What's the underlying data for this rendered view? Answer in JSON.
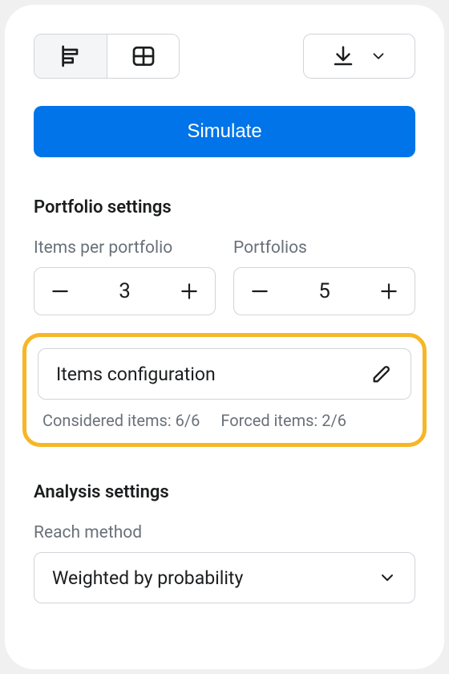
{
  "toolbar": {
    "simulate_label": "Simulate"
  },
  "portfolio": {
    "title": "Portfolio settings",
    "items_per_portfolio": {
      "label": "Items per portfolio",
      "value": "3"
    },
    "portfolios": {
      "label": "Portfolios",
      "value": "5"
    },
    "config": {
      "label": "Items configuration",
      "considered": "Considered items: 6/6",
      "forced": "Forced items: 2/6"
    }
  },
  "analysis": {
    "title": "Analysis settings",
    "reach_method": {
      "label": "Reach method",
      "value": "Weighted by probability"
    }
  }
}
